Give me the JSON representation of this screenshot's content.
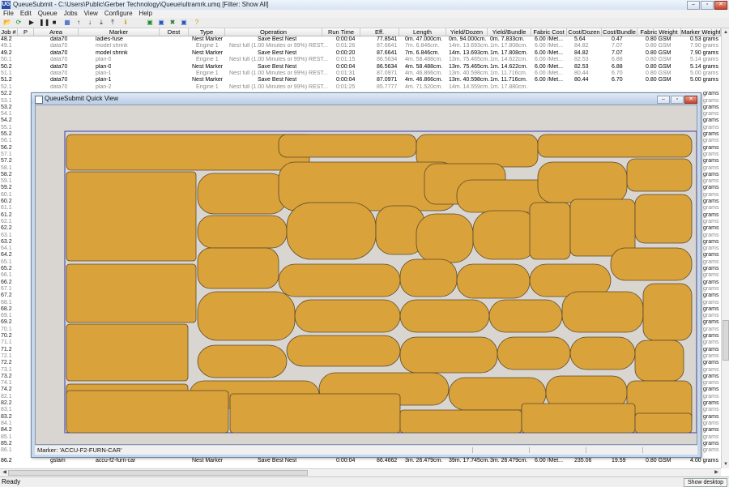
{
  "window": {
    "app_icon": "UG",
    "title": "QueueSubmit - C:\\Users\\Public\\Gerber Technology\\Queue\\ultramrk.umq   [Filter: Show All]",
    "controls": {
      "minimize": "–",
      "maximize": "▫",
      "close": "✕"
    }
  },
  "menu": [
    "File",
    "Edit",
    "Queue",
    "Jobs",
    "View",
    "Configure",
    "Help"
  ],
  "toolbar": {
    "icons": [
      "open-icon",
      "refresh-icon",
      "play-icon",
      "pause-icon",
      "stop-icon",
      "grid-icon",
      "move-up-icon",
      "move-down-icon",
      "move-bottom-icon",
      "move-top-icon",
      "info-icon",
      "nest-green-icon",
      "nest-blue-icon",
      "delete-icon",
      "nest-view-icon",
      "help-icon"
    ],
    "glyphs": [
      "📂",
      "⟳",
      "▶",
      "❚❚",
      "■",
      "▦",
      "↑",
      "↓",
      "⤓",
      "⤒",
      "ℹ",
      "▣",
      "▣",
      "✖",
      "▣",
      "?"
    ]
  },
  "columns": [
    "Job #",
    "P",
    "Area",
    "Marker",
    "Dest",
    "Type",
    "Operation",
    "Run Time",
    "Eff.",
    "Length",
    "Yield/Dozen",
    "Yield/Bundle",
    "Fabric Cost",
    "Cost/Dozen",
    "Cost/Bundle",
    "Fabric Weight",
    "Marker Weight"
  ],
  "rows": [
    {
      "job": "48.2",
      "area": "data70",
      "marker": "ladies-fuse",
      "type": "Nest Marker",
      "operation": "Save Best Nest",
      "run_time": "0:00:04",
      "eff": "77.8541",
      "length": "0m. 47.000cm.",
      "yield_dozen": "0m. 94.000cm.",
      "yield_bundle": "0m. 7.833cm.",
      "fabric_cost": "6.00 /Met...",
      "cost_dozen": "5.64",
      "cost_bundle": "0.47",
      "fabric_weight": "0.80 GSM",
      "marker_weight": "0.53 grams",
      "dim": false
    },
    {
      "job": "49.1",
      "area": "data70",
      "marker": "model shrink",
      "type": "Engine 1",
      "operation": "Nest full (1.00 Minutes or 99%) REST...",
      "run_time": "0:01:26",
      "eff": "87.6641",
      "length": "7m. 6.846cm.",
      "yield_dozen": "14m. 13.693cm.",
      "yield_bundle": "1m. 17.808cm.",
      "fabric_cost": "6.00 /Met...",
      "cost_dozen": "84.82",
      "cost_bundle": "7.07",
      "fabric_weight": "0.80 GSM",
      "marker_weight": "7.90 grams",
      "dim": true
    },
    {
      "job": "49.2",
      "area": "data70",
      "marker": "model shrink",
      "type": "Nest Marker",
      "operation": "Save Best Nest",
      "run_time": "0:00:20",
      "eff": "87.6641",
      "length": "7m. 6.846cm.",
      "yield_dozen": "14m. 13.693cm.",
      "yield_bundle": "1m. 17.808cm.",
      "fabric_cost": "6.00 /Met...",
      "cost_dozen": "84.82",
      "cost_bundle": "7.07",
      "fabric_weight": "0.80 GSM",
      "marker_weight": "7.90 grams",
      "dim": false
    },
    {
      "job": "50.1",
      "area": "data70",
      "marker": "plan-0",
      "type": "Engine 1",
      "operation": "Nest full (1.00 Minutes or 99%) REST...",
      "run_time": "0:01:15",
      "eff": "86.5634",
      "length": "4m. 58.488cm.",
      "yield_dozen": "13m. 75.465cm.",
      "yield_bundle": "1m. 14.622cm.",
      "fabric_cost": "6.00 /Met...",
      "cost_dozen": "82.53",
      "cost_bundle": "6.88",
      "fabric_weight": "0.80 GSM",
      "marker_weight": "5.14 grams",
      "dim": true
    },
    {
      "job": "50.2",
      "area": "data70",
      "marker": "plan-0",
      "type": "Nest Marker",
      "operation": "Save Best Nest",
      "run_time": "0:00:04",
      "eff": "86.5634",
      "length": "4m. 58.488cm.",
      "yield_dozen": "13m. 75.465cm.",
      "yield_bundle": "1m. 14.622cm.",
      "fabric_cost": "6.00 /Met...",
      "cost_dozen": "82.53",
      "cost_bundle": "6.88",
      "fabric_weight": "0.80 GSM",
      "marker_weight": "5.14 grams",
      "dim": false
    },
    {
      "job": "51.1",
      "area": "data70",
      "marker": "plan-1",
      "type": "Engine 1",
      "operation": "Nest full (1.00 Minutes or 99%) REST...",
      "run_time": "0:01:31",
      "eff": "87.0971",
      "length": "4m. 46.866cm.",
      "yield_dozen": "13m. 40.598cm.",
      "yield_bundle": "1m. 11.716cm.",
      "fabric_cost": "6.00 /Met...",
      "cost_dozen": "80.44",
      "cost_bundle": "6.70",
      "fabric_weight": "0.80 GSM",
      "marker_weight": "5.00 grams",
      "dim": true
    },
    {
      "job": "51.2",
      "area": "data70",
      "marker": "plan-1",
      "type": "Nest Marker",
      "operation": "Save Best Nest",
      "run_time": "0:00:04",
      "eff": "87.0971",
      "length": "4m. 46.866cm.",
      "yield_dozen": "13m. 40.598cm.",
      "yield_bundle": "1m. 11.716cm.",
      "fabric_cost": "6.00 /Met...",
      "cost_dozen": "80.44",
      "cost_bundle": "6.70",
      "fabric_weight": "0.80 GSM",
      "marker_weight": "5.00 grams",
      "dim": false
    },
    {
      "job": "52.1",
      "area": "data70",
      "marker": "plan-2",
      "type": "Engine 1",
      "operation": "Nest full (1.00 Minutes or 99%) REST...",
      "run_time": "0:01:25",
      "eff": "85.7777",
      "length": "4m. 71.520cm.",
      "yield_dozen": "14m. 14.559cm.",
      "yield_bundle": "1m. 17.880cm.",
      "fabric_cost": "",
      "cost_dozen": "",
      "cost_bundle": "",
      "fabric_weight": "",
      "marker_weight": "",
      "dim": true
    }
  ],
  "hidden_rows": [
    {
      "job": "52.2",
      "grams": "grams",
      "dim": false
    },
    {
      "job": "53.1",
      "grams": "grams",
      "dim": true
    },
    {
      "job": "53.2",
      "grams": "grams",
      "dim": false
    },
    {
      "job": "54.1",
      "grams": "grams",
      "dim": true
    },
    {
      "job": "54.2",
      "grams": "grams",
      "dim": false
    },
    {
      "job": "55.1",
      "grams": "grams",
      "dim": true
    },
    {
      "job": "55.2",
      "grams": "grams",
      "dim": false
    },
    {
      "job": "56.1",
      "grams": "grams",
      "dim": true
    },
    {
      "job": "56.2",
      "grams": "grams",
      "dim": false
    },
    {
      "job": "57.1",
      "grams": "grams",
      "dim": true
    },
    {
      "job": "57.2",
      "grams": "grams",
      "dim": false
    },
    {
      "job": "58.1",
      "grams": "grams",
      "dim": true
    },
    {
      "job": "58.2",
      "grams": "grams",
      "dim": false
    },
    {
      "job": "59.1",
      "grams": "grams",
      "dim": true
    },
    {
      "job": "59.2",
      "grams": "grams",
      "dim": false
    },
    {
      "job": "60.1",
      "grams": "grams",
      "dim": true
    },
    {
      "job": "60.2",
      "grams": "grams",
      "dim": false
    },
    {
      "job": "61.1",
      "grams": "grams",
      "dim": true
    },
    {
      "job": "61.2",
      "grams": "grams",
      "dim": false
    },
    {
      "job": "62.1",
      "grams": "grams",
      "dim": true
    },
    {
      "job": "62.2",
      "grams": "grams",
      "dim": false
    },
    {
      "job": "63.1",
      "grams": "grams",
      "dim": true
    },
    {
      "job": "63.2",
      "grams": "grams",
      "dim": false
    },
    {
      "job": "64.1",
      "grams": "grams",
      "dim": true
    },
    {
      "job": "64.2",
      "grams": "grams",
      "dim": false
    },
    {
      "job": "65.1",
      "grams": "grams",
      "dim": true
    },
    {
      "job": "65.2",
      "grams": "grams",
      "dim": false
    },
    {
      "job": "66.1",
      "grams": "grams",
      "dim": true
    },
    {
      "job": "66.2",
      "grams": "grams",
      "dim": false
    },
    {
      "job": "67.1",
      "grams": "grams",
      "dim": true
    },
    {
      "job": "67.2",
      "grams": "grams",
      "dim": false
    },
    {
      "job": "68.1",
      "grams": "grams",
      "dim": true
    },
    {
      "job": "68.2",
      "grams": "grams",
      "dim": false
    },
    {
      "job": "69.1",
      "grams": "grams",
      "dim": true
    },
    {
      "job": "69.2",
      "grams": "grams",
      "dim": false
    },
    {
      "job": "70.1",
      "grams": "grams",
      "dim": true
    },
    {
      "job": "70.2",
      "grams": "grams",
      "dim": false
    },
    {
      "job": "71.1",
      "grams": "grams",
      "dim": true
    },
    {
      "job": "71.2",
      "grams": "grams",
      "dim": false
    },
    {
      "job": "72.1",
      "grams": "grams",
      "dim": true
    },
    {
      "job": "72.2",
      "grams": "grams",
      "dim": false
    },
    {
      "job": "73.1",
      "grams": "grams",
      "dim": true
    },
    {
      "job": "73.2",
      "grams": "grams",
      "dim": false
    },
    {
      "job": "74.1",
      "grams": "grams",
      "dim": true
    },
    {
      "job": "74.2",
      "grams": "grams",
      "dim": false
    },
    {
      "job": "82.1",
      "grams": "grams",
      "dim": true
    },
    {
      "job": "82.2",
      "grams": "grams",
      "dim": false
    },
    {
      "job": "83.1",
      "grams": "grams",
      "dim": true
    },
    {
      "job": "83.2",
      "grams": "grams",
      "dim": false
    },
    {
      "job": "84.1",
      "grams": "grams",
      "dim": true
    },
    {
      "job": "84.2",
      "grams": "grams",
      "dim": false
    },
    {
      "job": "85.1",
      "grams": "grams",
      "dim": true
    },
    {
      "job": "85.2",
      "grams": "grams",
      "dim": false
    },
    {
      "job": "86.1",
      "grams": "grams",
      "dim": true
    }
  ],
  "last_row": {
    "job": "86.2",
    "area": "gslam",
    "marker": "accu-f2-furn-car",
    "type": "Nest Marker",
    "operation": "Save Best Nest",
    "run_time": "0:00:04",
    "eff": "86.4662",
    "length": "3m. 26.479cm.",
    "yield_dozen": "39m. 17.745cm.",
    "yield_bundle": "3m. 26.479cm.",
    "fabric_cost": "6.00 /Met...",
    "cost_dozen": "235.06",
    "cost_bundle": "19.59",
    "fabric_weight": "0.80 GSM",
    "marker_weight": "4.00 grams"
  },
  "quick_view": {
    "title": "QueueSubmit Quick View",
    "marker_label": "Marker: 'ACCU-F2-FURN-CAR'",
    "piece_color": "#d9a23b",
    "piece_outline": "#5b4a2a",
    "canvas_color": "#d9d6d2",
    "fabric_border": "#3a3aa8"
  },
  "status": {
    "text": "Ready",
    "show_desktop": "Show desktop"
  }
}
